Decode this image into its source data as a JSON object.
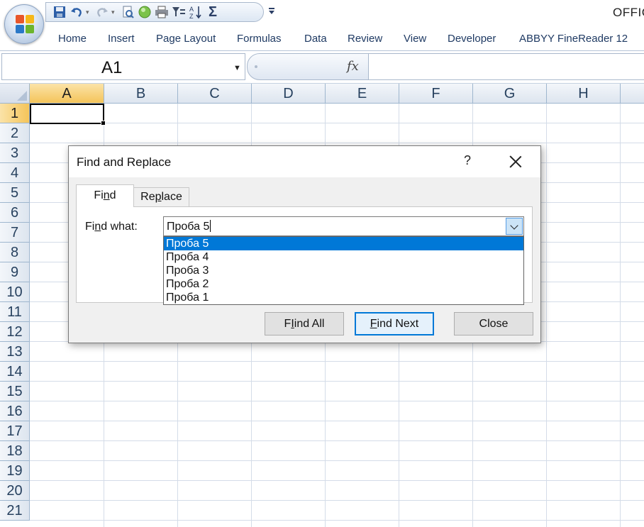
{
  "app": {
    "title": "OFFIC",
    "office_button_icon": "office-logo-icon"
  },
  "quick_access": {
    "items": [
      "save-icon",
      "undo-icon",
      "redo-icon",
      "print-preview-icon",
      "record-icon",
      "print-icon",
      "filter-icon",
      "sort-az-icon",
      "sum-icon",
      "customize-icon"
    ],
    "sum_glyph": "Σ"
  },
  "ribbon": {
    "tabs": [
      "Home",
      "Insert",
      "Page Layout",
      "Formulas",
      "Data",
      "Review",
      "View",
      "Developer",
      "ABBYY FineReader 12"
    ]
  },
  "formula_bar": {
    "name_box": "A1",
    "fx_label": "fx",
    "formula": ""
  },
  "sheet": {
    "columns": [
      "A",
      "B",
      "C",
      "D",
      "E",
      "F",
      "G",
      "H"
    ],
    "rows": [
      "1",
      "2",
      "3",
      "4",
      "5",
      "6",
      "7",
      "8",
      "9",
      "10",
      "11",
      "12",
      "13",
      "14",
      "15",
      "16",
      "17",
      "18",
      "19",
      "20",
      "21"
    ],
    "active_cell": "A1"
  },
  "dialog": {
    "title": "Find and Replace",
    "help": "?",
    "tabs": {
      "find": {
        "pre": "Fi",
        "u": "n",
        "post": "d"
      },
      "replace": {
        "pre": "Re",
        "u": "p",
        "post": "lace"
      }
    },
    "find_what_label": {
      "pre": "Fi",
      "u": "n",
      "post": "d what:"
    },
    "find_what_value": "Проба 5",
    "history": [
      "Проба 5",
      "Проба 4",
      "Проба 3",
      "Проба 2",
      "Проба 1"
    ],
    "selected_history_index": 0,
    "buttons": {
      "find_all": {
        "pre": "",
        "u": "I",
        "post": "ind All",
        "lead": "F"
      },
      "find_next": {
        "pre": "",
        "u": "F",
        "post": "ind Next"
      },
      "close": "Close"
    }
  },
  "colors": {
    "selection_blue": "#0078d7",
    "active_header": "#f4c45a",
    "ribbon_text": "#1f3a63"
  }
}
